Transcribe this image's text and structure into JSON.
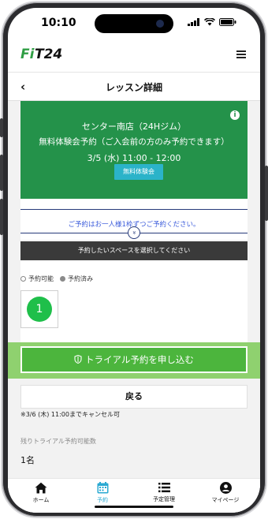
{
  "status_bar": {
    "time": "10:10"
  },
  "header": {
    "logo_text": "FiT24",
    "back_glyph": "‹",
    "title": "レッスン詳細"
  },
  "banner": {
    "store": "センター南店（24Hジム）",
    "description": "無料体験会予約（ご入会前の方のみ予約できます）",
    "datetime": "3/5 (水) 11:00 - 12:00",
    "tag": "無料体験会",
    "info_glyph": "i",
    "bg_color": "#24924a"
  },
  "notice": {
    "text": "ご予約はお一人様1枠ずつご予約ください。",
    "chevron_glyph": "»"
  },
  "select_bar": "予約したいスペースを選択してください",
  "legend": {
    "available": "予約可能",
    "reserved": "予約済み"
  },
  "slot": {
    "number": "1",
    "color": "#1fbf4a"
  },
  "buttons": {
    "trial": "トライアル予約を申し込む",
    "back": "戻る"
  },
  "cancel_note": "※3/6 (木) 11:00までキャンセル可",
  "remaining": {
    "label": "残りトライアル予約可能数",
    "value": "1名"
  },
  "tabbar": [
    {
      "label": "ホーム",
      "icon": "home-icon"
    },
    {
      "label": "予約",
      "icon": "calendar-icon",
      "active": true
    },
    {
      "label": "予定管理",
      "icon": "list-icon"
    },
    {
      "label": "マイページ",
      "icon": "user-icon"
    }
  ]
}
